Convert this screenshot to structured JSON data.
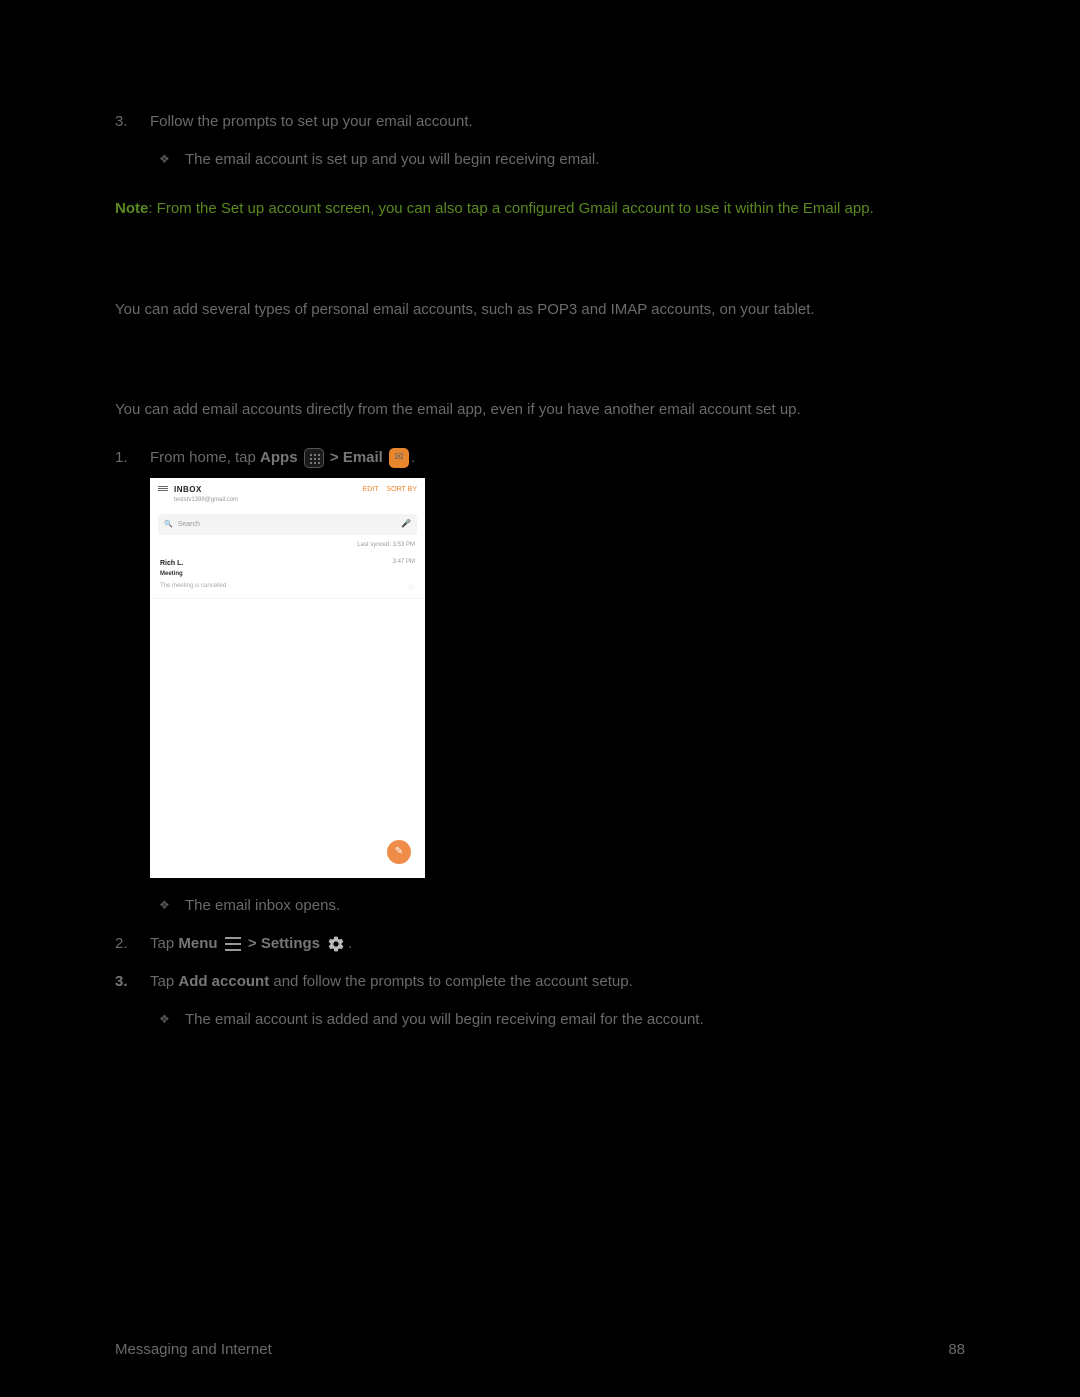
{
  "topList": {
    "item3_num": "3.",
    "item3_text": "Follow the prompts to set up your email account.",
    "item3_sub": "The email account is set up and you will begin receiving email."
  },
  "note": {
    "label": "Note",
    "text": ": From the Set up account screen, you can also tap a configured Gmail account to use it within the Email app."
  },
  "intro1": "You can add several types of personal email accounts, such as POP3 and IMAP accounts, on your tablet.",
  "intro2": "You can add email accounts directly from the email app, even if you have another email account set up.",
  "steps": {
    "s1": {
      "num": "1.",
      "pre": "From home, tap ",
      "apps": "Apps",
      "sep": " > ",
      "email": "Email",
      "post": ".",
      "sub": "The email inbox opens."
    },
    "s2": {
      "num": "2.",
      "pre": "Tap ",
      "menu": "Menu",
      "sep": " > ",
      "settings": "Settings",
      "post": "."
    },
    "s3": {
      "num": "3.",
      "pre": "Tap ",
      "add": "Add account",
      "post": " and follow the prompts to complete the account setup.",
      "sub": "The email account is added and you will begin receiving email for the account."
    }
  },
  "screenshot": {
    "inbox_label": "INBOX",
    "account_email": "teststv1398@gmail.com",
    "edit": "EDIT",
    "sort": "SORT BY",
    "search_placeholder": "Search",
    "last_synced": "Last synced: 3:53 PM",
    "sender": "Rich L.",
    "time": "3:47 PM",
    "subject": "Meeting",
    "preview": "The meeting is cancelled"
  },
  "footer": {
    "section": "Messaging and Internet",
    "page": "88"
  }
}
